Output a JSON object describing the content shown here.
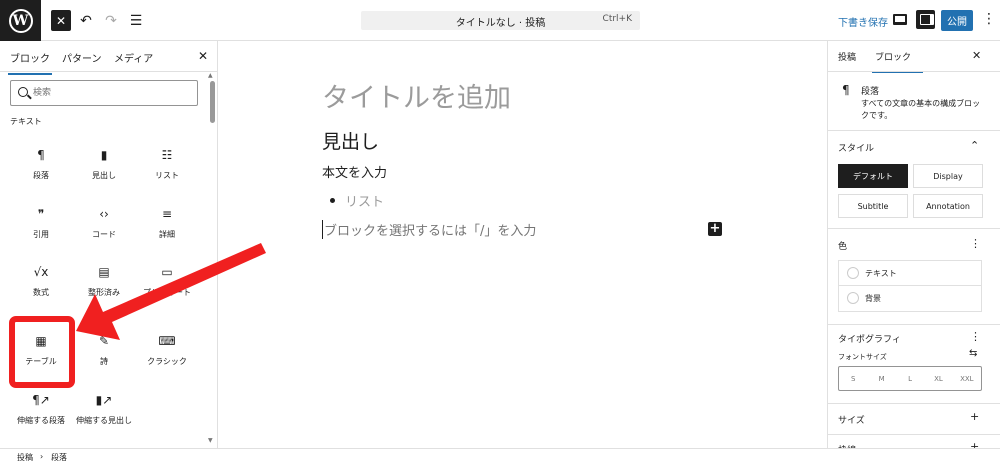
{
  "toolbar": {
    "close_symbol": "✕",
    "undo_symbol": "↶",
    "redo_symbol": "↷",
    "list_view_symbol": "☰",
    "document_title": "タイトルなし · 投稿",
    "shortcut": "Ctrl+K",
    "save_draft": "下書き保存",
    "publish": "公開",
    "more_symbol": "⋮"
  },
  "inserter": {
    "tabs": [
      "ブロック",
      "パターン",
      "メディア"
    ],
    "close_symbol": "✕",
    "search_placeholder": "検索",
    "category": "テキスト",
    "blocks": [
      {
        "icon": "¶",
        "label": "段落"
      },
      {
        "icon": "▮",
        "label": "見出し"
      },
      {
        "icon": "☷",
        "label": "リスト"
      },
      {
        "icon": "❞",
        "label": "引用"
      },
      {
        "icon": "‹›",
        "label": "コード"
      },
      {
        "icon": "≡",
        "label": "詳細"
      },
      {
        "icon": "√x",
        "label": "数式"
      },
      {
        "icon": "▤",
        "label": "整形済み"
      },
      {
        "icon": "▭",
        "label": "プルクオート"
      },
      {
        "icon": "▦",
        "label": "テーブル"
      },
      {
        "icon": "✎",
        "label": "詩"
      },
      {
        "icon": "⌨",
        "label": "クラシック"
      },
      {
        "icon": "¶↗",
        "label": "伸縮する段落"
      },
      {
        "icon": "▮↗",
        "label": "伸縮する見出し"
      }
    ]
  },
  "canvas": {
    "title_placeholder": "タイトルを追加",
    "heading": "見出し",
    "paragraph": "本文を入力",
    "list_item": "リスト",
    "appender_placeholder": "ブロックを選択するには「/」を入力",
    "add_symbol": "+"
  },
  "sidebar": {
    "tabs": [
      "投稿",
      "ブロック"
    ],
    "close_symbol": "✕",
    "block_icon": "¶",
    "block_name": "段落",
    "block_description": "すべての文章の基本の構成ブロックです。",
    "style_title": "スタイル",
    "style_toggle": "⌃",
    "styles": [
      "デフォルト",
      "Display",
      "Subtitle",
      "Annotation"
    ],
    "color_title": "色",
    "section_menu": "⋮",
    "colors": [
      "テキスト",
      "背景"
    ],
    "typography_title": "タイポグラフィ",
    "font_size_label": "フォントサイズ",
    "font_size_ctrl": "⇆",
    "font_sizes": [
      "S",
      "M",
      "L",
      "XL",
      "XXL"
    ],
    "size_title": "サイズ",
    "add_symbol": "+",
    "border_title": "枠線"
  },
  "statusbar": {
    "crumbs": [
      "投稿",
      "段落"
    ],
    "separator": "›"
  },
  "colors": {
    "accent": "#2271b1",
    "dark": "#1e1e1e",
    "annotation_red": "#f02020"
  }
}
